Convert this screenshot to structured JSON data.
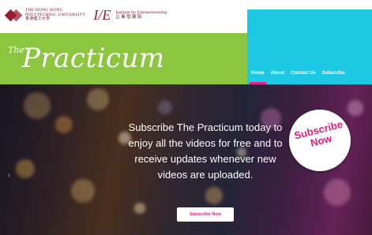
{
  "header": {
    "polyu_line1": "THE HONG KONG",
    "polyu_line2": "POLYTECHNIC UNIVERSITY",
    "polyu_zh": "香港理工大學",
    "ife_mark": "I/E",
    "ife_line1": "Institute for Entrepreneurship",
    "ife_zh": "企 業 發 展 院"
  },
  "brand": {
    "prefix": "The",
    "name": "Practicum"
  },
  "nav": {
    "items": [
      {
        "label": "Home",
        "active": true
      },
      {
        "label": "About",
        "active": false
      },
      {
        "label": "Contact Us",
        "active": false
      },
      {
        "label": "Subscribe",
        "active": false
      }
    ]
  },
  "hero": {
    "lines": [
      "Subscribe The Practicum today to",
      "enjoy all the videos for free and to",
      "receive updates whenever new",
      "videos are uploaded."
    ],
    "badge_line1": "Subscribe",
    "badge_line2": "Now",
    "button_label": "Subscribe Now",
    "prev_arrow": "‹"
  },
  "colors": {
    "green": "#8cc63f",
    "cyan": "#1cc8e3",
    "pink": "#e0207a",
    "maroon": "#9b1c2e"
  }
}
